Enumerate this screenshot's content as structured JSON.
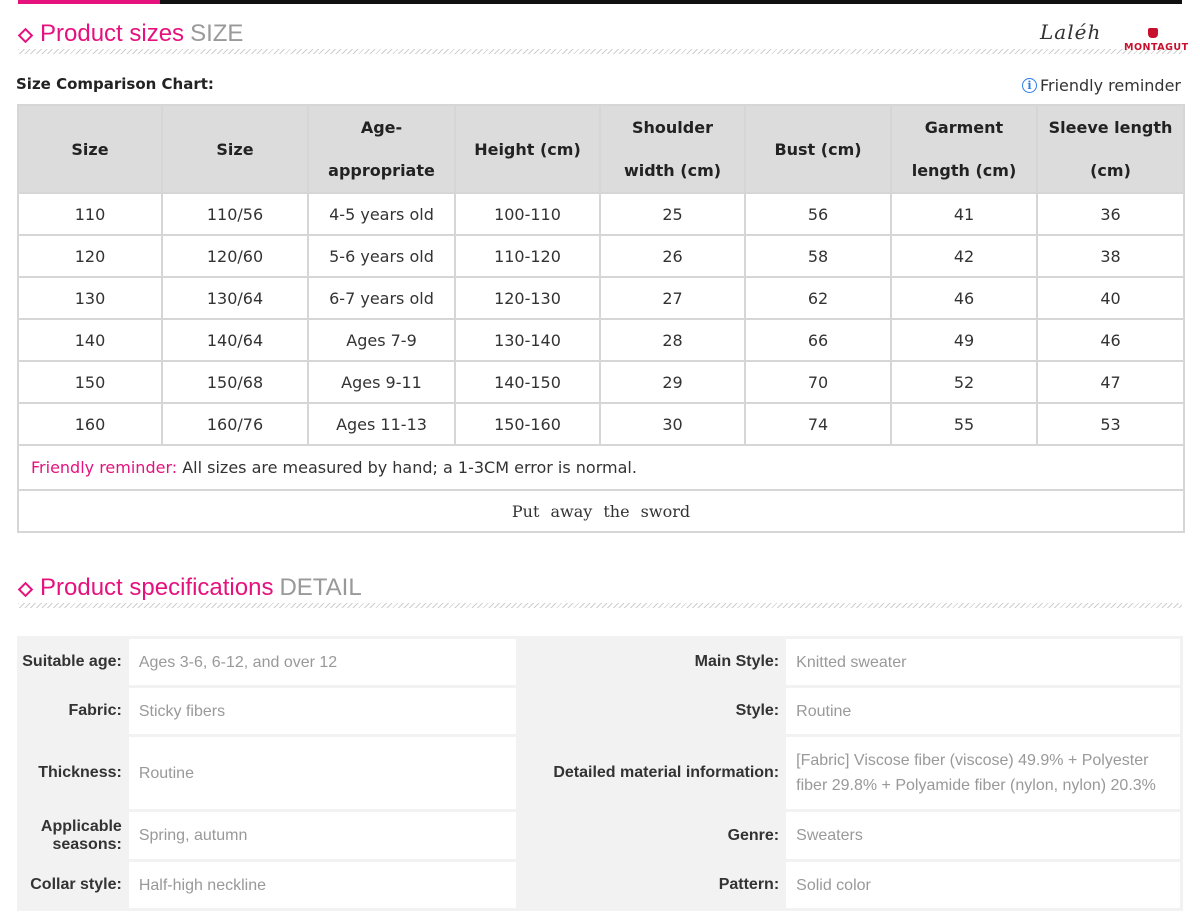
{
  "size_section": {
    "title": "Product sizes",
    "title_en": "SIZE"
  },
  "logo": {
    "script": "Laléh",
    "brand": "MONTAGUT"
  },
  "chart_label": "Size Comparison Chart:",
  "friendly_reminder_link": "Friendly reminder",
  "size_table": {
    "headers": [
      "Size",
      "Size",
      "Age-appropriate",
      "Height (cm)",
      "Shoulder width (cm)",
      "Bust (cm)",
      "Garment length (cm)",
      "Sleeve length (cm)"
    ],
    "rows": [
      [
        "110",
        "110/56",
        "4-5 years old",
        "100-110",
        "25",
        "56",
        "41",
        "36"
      ],
      [
        "120",
        "120/60",
        "5-6 years old",
        "110-120",
        "26",
        "58",
        "42",
        "38"
      ],
      [
        "130",
        "130/64",
        "6-7 years old",
        "120-130",
        "27",
        "62",
        "46",
        "40"
      ],
      [
        "140",
        "140/64",
        "Ages 7-9",
        "130-140",
        "28",
        "66",
        "49",
        "46"
      ],
      [
        "150",
        "150/68",
        "Ages 9-11",
        "140-150",
        "29",
        "70",
        "52",
        "47"
      ],
      [
        "160",
        "160/76",
        "Ages 11-13",
        "150-160",
        "30",
        "74",
        "55",
        "53"
      ]
    ],
    "note_label": "Friendly reminder:",
    "note_text": " All sizes are measured by hand; a 1-3CM error is normal.",
    "footer": "Put away the sword"
  },
  "spec_section": {
    "title": "Product specifications",
    "title_en": "DETAIL"
  },
  "specs": [
    {
      "k1": "Suitable age:",
      "v1": "Ages 3-6, 6-12, and over 12",
      "k2": "Main Style:",
      "v2": "Knitted sweater"
    },
    {
      "k1": "Fabric:",
      "v1": "Sticky fibers",
      "k2": "Style:",
      "v2": "Routine"
    },
    {
      "k1": "Thickness:",
      "v1": "Routine",
      "k2": "Detailed material information:",
      "v2": "[Fabric] Viscose fiber (viscose) 49.9% + Polyester fiber 29.8% + Polyamide fiber (nylon, nylon) 20.3%"
    },
    {
      "k1": "Applicable seasons:",
      "v1": "Spring, autumn",
      "k2": "Genre:",
      "v2": "Sweaters"
    },
    {
      "k1": "Collar style:",
      "v1": "Half-high neckline",
      "k2": "Pattern:",
      "v2": "Solid color"
    }
  ],
  "colors": {
    "accent": "#e5127e",
    "header_bg": "#dcdcdc",
    "muted": "#999999",
    "info_blue": "#2b7de9"
  }
}
